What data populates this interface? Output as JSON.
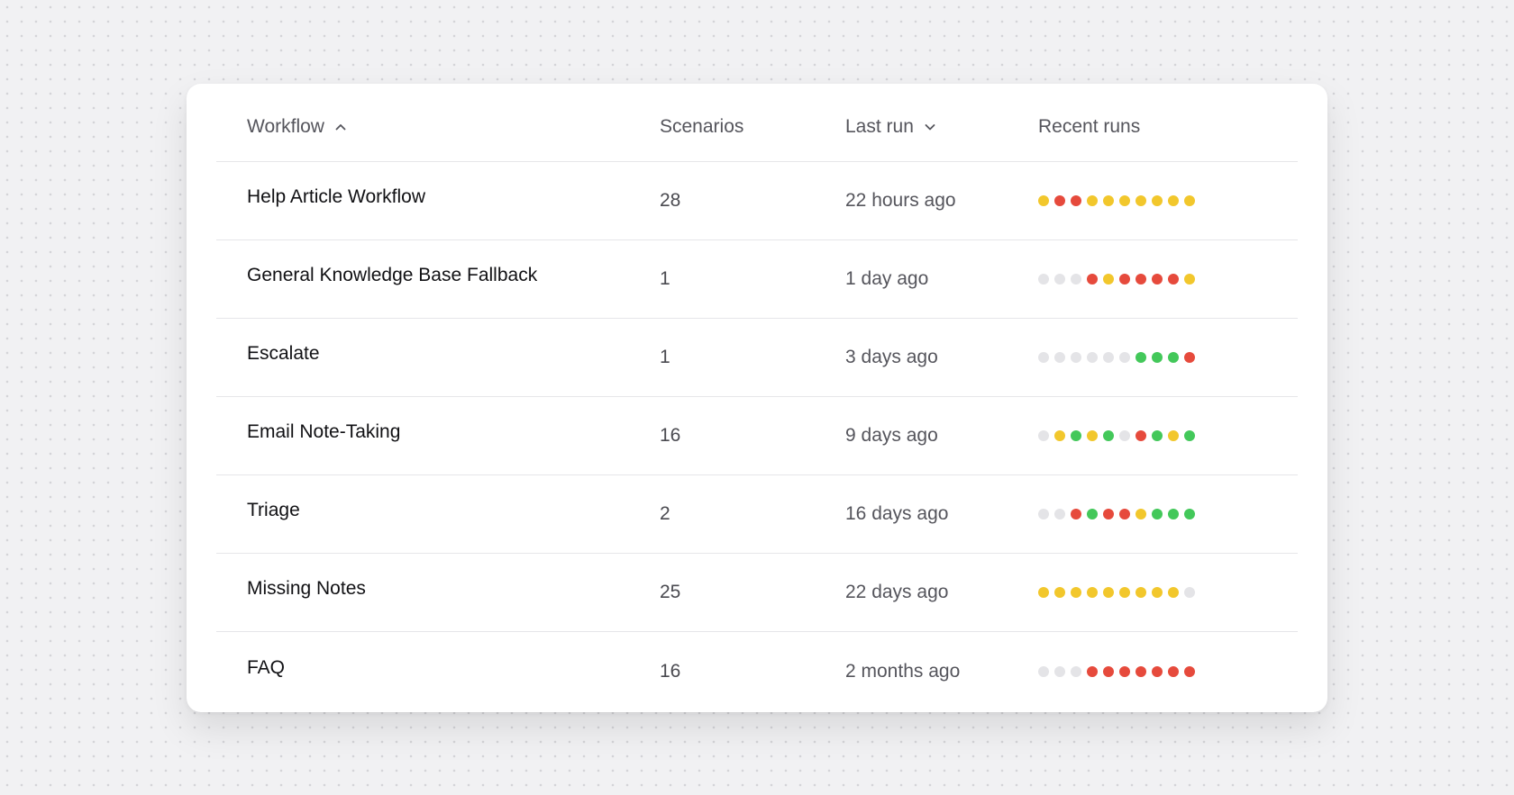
{
  "table": {
    "headers": {
      "workflow": "Workflow",
      "scenarios": "Scenarios",
      "last_run": "Last run",
      "recent_runs": "Recent runs"
    },
    "sort": {
      "workflow": "ascending",
      "last_run": "descending"
    },
    "status_colors": {
      "success": "#43c85a",
      "warning": "#f2c72c",
      "failure": "#e64a3c",
      "none": "#e4e4e7"
    },
    "rows": [
      {
        "name": "Help Article Workflow",
        "scenarios": "28",
        "last_run": "22 hours ago",
        "recent_runs": [
          "yellow",
          "red",
          "red",
          "yellow",
          "yellow",
          "yellow",
          "yellow",
          "yellow",
          "yellow",
          "yellow"
        ]
      },
      {
        "name": "General Knowledge Base Fallback",
        "scenarios": "1",
        "last_run": "1 day ago",
        "recent_runs": [
          "gray",
          "gray",
          "gray",
          "red",
          "yellow",
          "red",
          "red",
          "red",
          "red",
          "yellow"
        ]
      },
      {
        "name": "Escalate",
        "scenarios": "1",
        "last_run": "3 days ago",
        "recent_runs": [
          "gray",
          "gray",
          "gray",
          "gray",
          "gray",
          "gray",
          "green",
          "green",
          "green",
          "red"
        ]
      },
      {
        "name": "Email Note-Taking",
        "scenarios": "16",
        "last_run": "9 days ago",
        "recent_runs": [
          "gray",
          "yellow",
          "green",
          "yellow",
          "green",
          "gray",
          "red",
          "green",
          "yellow",
          "green"
        ]
      },
      {
        "name": "Triage",
        "scenarios": "2",
        "last_run": "16 days ago",
        "recent_runs": [
          "gray",
          "gray",
          "red",
          "green",
          "red",
          "red",
          "yellow",
          "green",
          "green",
          "green"
        ]
      },
      {
        "name": "Missing Notes",
        "scenarios": "25",
        "last_run": "22 days ago",
        "recent_runs": [
          "yellow",
          "yellow",
          "yellow",
          "yellow",
          "yellow",
          "yellow",
          "yellow",
          "yellow",
          "yellow",
          "gray"
        ]
      },
      {
        "name": "FAQ",
        "scenarios": "16",
        "last_run": "2 months ago",
        "recent_runs": [
          "gray",
          "gray",
          "gray",
          "red",
          "red",
          "red",
          "red",
          "red",
          "red",
          "red"
        ]
      }
    ]
  }
}
